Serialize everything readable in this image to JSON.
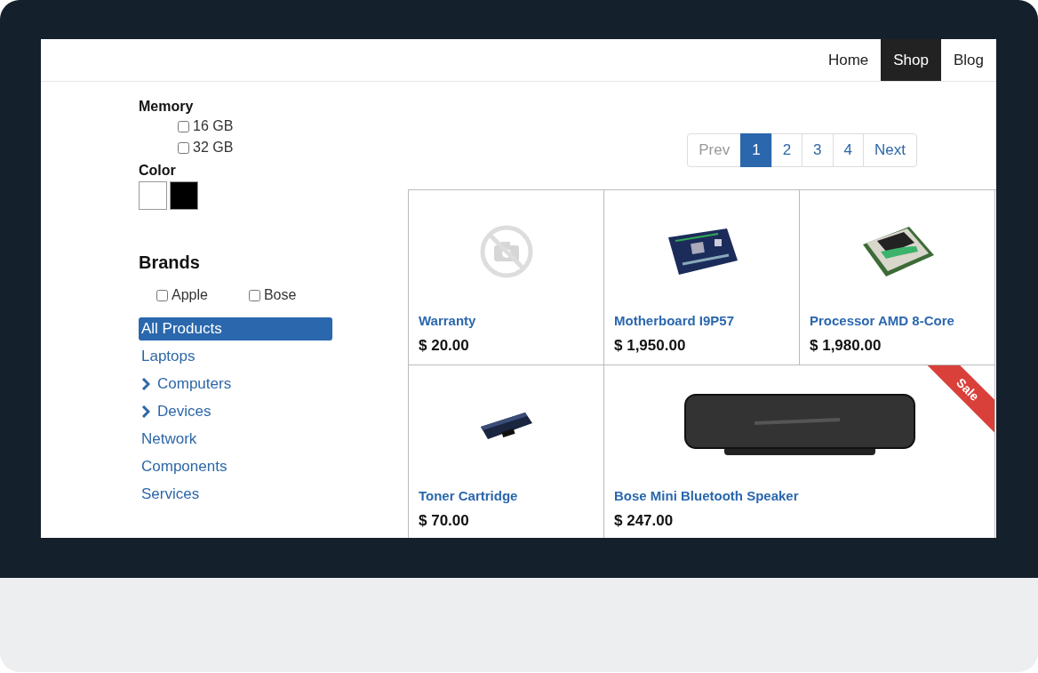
{
  "nav": [
    {
      "label": "Home",
      "selected": false
    },
    {
      "label": "Shop",
      "selected": true
    },
    {
      "label": "Blog",
      "selected": false
    }
  ],
  "filters": {
    "memory": {
      "title": "Memory",
      "options": [
        {
          "label": "16 GB",
          "checked": false
        },
        {
          "label": "32 GB",
          "checked": false
        }
      ]
    },
    "color": {
      "title": "Color",
      "swatches": [
        {
          "color": "#ffffff"
        },
        {
          "color": "#000000"
        }
      ]
    },
    "brands": {
      "title": "Brands",
      "options": [
        {
          "label": "Apple",
          "checked": false
        },
        {
          "label": "Bose",
          "checked": false
        }
      ]
    }
  },
  "categories": [
    {
      "label": "All Products",
      "selected": true,
      "expandable": false
    },
    {
      "label": "Laptops",
      "selected": false,
      "expandable": false
    },
    {
      "label": "Computers",
      "selected": false,
      "expandable": true
    },
    {
      "label": "Devices",
      "selected": false,
      "expandable": true
    },
    {
      "label": "Network",
      "selected": false,
      "expandable": false
    },
    {
      "label": "Components",
      "selected": false,
      "expandable": false
    },
    {
      "label": "Services",
      "selected": false,
      "expandable": false
    }
  ],
  "pagination": [
    {
      "label": "Prev",
      "selected": false,
      "disabled": true
    },
    {
      "label": "1",
      "selected": true,
      "disabled": false
    },
    {
      "label": "2",
      "selected": false,
      "disabled": false
    },
    {
      "label": "3",
      "selected": false,
      "disabled": false
    },
    {
      "label": "4",
      "selected": false,
      "disabled": false
    },
    {
      "label": "Next",
      "selected": false,
      "disabled": false
    }
  ],
  "products": [
    {
      "name": "Warranty",
      "price": "$ 20.00",
      "kind": "no-photo",
      "wide": false
    },
    {
      "name": "Motherboard I9P57",
      "price": "$ 1,950.00",
      "kind": "motherboard",
      "wide": false
    },
    {
      "name": "Processor AMD 8-Core",
      "price": "$ 1,980.00",
      "kind": "cpu",
      "wide": false
    },
    {
      "name": "Toner Cartridge",
      "price": "$ 70.00",
      "kind": "toner",
      "wide": false
    },
    {
      "name": "Bose Mini Bluetooth Speaker",
      "price": "$ 247.00",
      "kind": "speaker",
      "wide": true,
      "ribbon": "Sale"
    }
  ]
}
